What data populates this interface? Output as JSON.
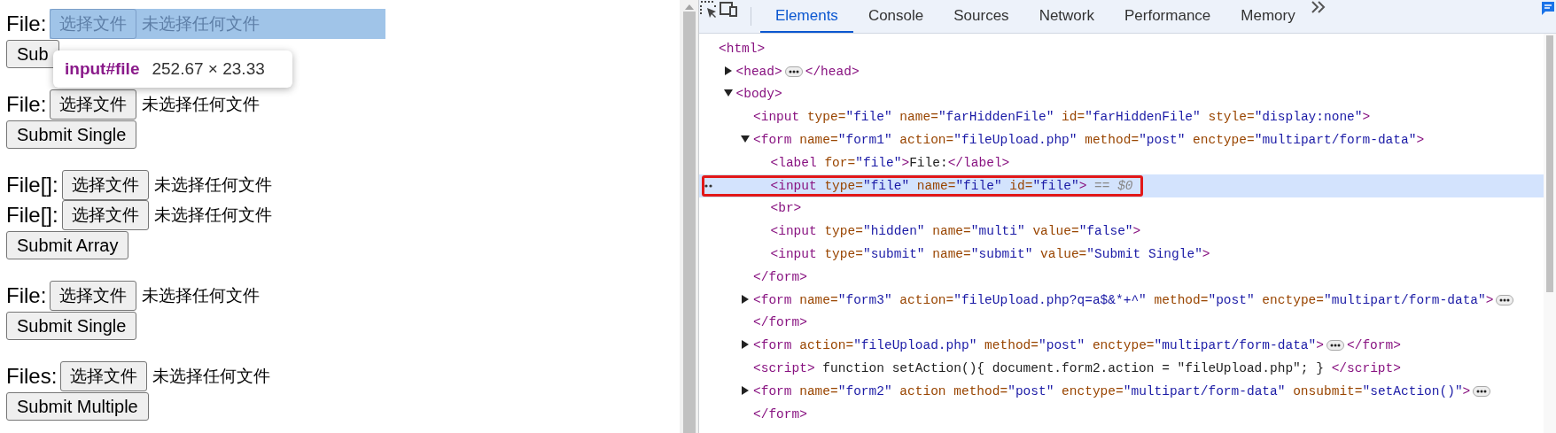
{
  "page": {
    "forms": [
      {
        "inputs": [
          {
            "label": "File:",
            "button": "选择文件",
            "status": "未选择任何文件",
            "highlighted": true
          }
        ],
        "submit": "Sub"
      },
      {
        "inputs": [
          {
            "label": "File:",
            "button": "选择文件",
            "status": "未选择任何文件",
            "highlighted": false
          }
        ],
        "submit": "Submit Single"
      },
      {
        "inputs": [
          {
            "label": "File[]:",
            "button": "选择文件",
            "status": "未选择任何文件",
            "highlighted": false
          },
          {
            "label": "File[]:",
            "button": "选择文件",
            "status": "未选择任何文件",
            "highlighted": false
          }
        ],
        "submit": "Submit Array"
      },
      {
        "inputs": [
          {
            "label": "File:",
            "button": "选择文件",
            "status": "未选择任何文件",
            "highlighted": false
          }
        ],
        "submit": "Submit Single"
      },
      {
        "inputs": [
          {
            "label": "Files:",
            "button": "选择文件",
            "status": "未选择任何文件",
            "highlighted": false
          }
        ],
        "submit": "Submit Multiple"
      }
    ],
    "inspect_tooltip": {
      "selector": "input#file",
      "size": "252.67 × 23.33"
    }
  },
  "devtools": {
    "tabs": [
      {
        "label": "Elements",
        "selected": true
      },
      {
        "label": "Console",
        "selected": false
      },
      {
        "label": "Sources",
        "selected": false
      },
      {
        "label": "Network",
        "selected": false
      },
      {
        "label": "Performance",
        "selected": false
      },
      {
        "label": "Memory",
        "selected": false
      }
    ],
    "tree": [
      {
        "selected": false,
        "open": [
          {
            "kind": "code",
            "spans": [
              {
                "kind": "tag",
                "text": "<html>"
              }
            ]
          }
        ],
        "children": [
          {
            "selected": false,
            "expanded": false,
            "open": [
              {
                "kind": "code",
                "spans": [
                  {
                    "kind": "tag",
                    "text": "<head>"
                  }
                ]
              },
              {
                "kind": "ellipsis"
              },
              {
                "kind": "code",
                "spans": [
                  {
                    "kind": "tag",
                    "text": "</head>"
                  }
                ]
              }
            ]
          },
          {
            "selected": false,
            "expanded": true,
            "open": [
              {
                "kind": "code",
                "spans": [
                  {
                    "kind": "tag",
                    "text": "<body>"
                  }
                ]
              }
            ],
            "children": [
              {
                "selected": false,
                "open": [
                  {
                    "kind": "code",
                    "spans": [
                      {
                        "kind": "tag",
                        "text": "<input"
                      },
                      {
                        "kind": "name",
                        "text": " type="
                      },
                      {
                        "kind": "value",
                        "text": "\"file\""
                      },
                      {
                        "kind": "name",
                        "text": " name="
                      },
                      {
                        "kind": "value",
                        "text": "\"farHiddenFile\""
                      },
                      {
                        "kind": "name",
                        "text": " id="
                      },
                      {
                        "kind": "value",
                        "text": "\"farHiddenFile\""
                      },
                      {
                        "kind": "name",
                        "text": " style="
                      },
                      {
                        "kind": "value",
                        "text": "\"display:none\""
                      },
                      {
                        "kind": "tag",
                        "text": ">"
                      }
                    ]
                  }
                ]
              },
              {
                "selected": false,
                "expanded": true,
                "open": [
                  {
                    "kind": "code",
                    "spans": [
                      {
                        "kind": "tag",
                        "text": "<form"
                      },
                      {
                        "kind": "name",
                        "text": " name="
                      },
                      {
                        "kind": "value",
                        "text": "\"form1\""
                      },
                      {
                        "kind": "name",
                        "text": " action="
                      },
                      {
                        "kind": "value",
                        "text": "\"fileUpload.php\""
                      },
                      {
                        "kind": "name",
                        "text": " method="
                      },
                      {
                        "kind": "value",
                        "text": "\"post\""
                      },
                      {
                        "kind": "name",
                        "text": " enctype="
                      },
                      {
                        "kind": "value",
                        "text": "\"multipart/form-data\""
                      },
                      {
                        "kind": "tag",
                        "text": ">"
                      }
                    ]
                  }
                ],
                "children": [
                  {
                    "selected": false,
                    "open": [
                      {
                        "kind": "code",
                        "spans": [
                          {
                            "kind": "tag",
                            "text": "<label"
                          },
                          {
                            "kind": "name",
                            "text": " for="
                          },
                          {
                            "kind": "value",
                            "text": "\"file\""
                          },
                          {
                            "kind": "tag",
                            "text": ">"
                          },
                          {
                            "kind": "text",
                            "text": "File:"
                          },
                          {
                            "kind": "tag",
                            "text": "</label>"
                          }
                        ]
                      }
                    ]
                  },
                  {
                    "selected": true,
                    "outlined": true,
                    "open": [
                      {
                        "kind": "code",
                        "spans": [
                          {
                            "kind": "tag",
                            "text": "<input"
                          },
                          {
                            "kind": "name",
                            "text": " type="
                          },
                          {
                            "kind": "value",
                            "text": "\"file\""
                          },
                          {
                            "kind": "name",
                            "text": " name="
                          },
                          {
                            "kind": "value",
                            "text": "\"file\""
                          },
                          {
                            "kind": "name",
                            "text": " id="
                          },
                          {
                            "kind": "value",
                            "text": "\"file\""
                          },
                          {
                            "kind": "tag",
                            "text": ">"
                          },
                          {
                            "kind": "hint",
                            "text": " == $0"
                          }
                        ]
                      }
                    ]
                  },
                  {
                    "selected": false,
                    "open": [
                      {
                        "kind": "code",
                        "spans": [
                          {
                            "kind": "tag",
                            "text": "<br>"
                          }
                        ]
                      }
                    ]
                  },
                  {
                    "selected": false,
                    "open": [
                      {
                        "kind": "code",
                        "spans": [
                          {
                            "kind": "tag",
                            "text": "<input"
                          },
                          {
                            "kind": "name",
                            "text": " type="
                          },
                          {
                            "kind": "value",
                            "text": "\"hidden\""
                          },
                          {
                            "kind": "name",
                            "text": " name="
                          },
                          {
                            "kind": "value",
                            "text": "\"multi\""
                          },
                          {
                            "kind": "name",
                            "text": " value="
                          },
                          {
                            "kind": "value",
                            "text": "\"false\""
                          },
                          {
                            "kind": "tag",
                            "text": ">"
                          }
                        ]
                      }
                    ]
                  },
                  {
                    "selected": false,
                    "open": [
                      {
                        "kind": "code",
                        "spans": [
                          {
                            "kind": "tag",
                            "text": "<input"
                          },
                          {
                            "kind": "name",
                            "text": " type="
                          },
                          {
                            "kind": "value",
                            "text": "\"submit\""
                          },
                          {
                            "kind": "name",
                            "text": " name="
                          },
                          {
                            "kind": "value",
                            "text": "\"submit\""
                          },
                          {
                            "kind": "name",
                            "text": " value="
                          },
                          {
                            "kind": "value",
                            "text": "\"Submit Single\""
                          },
                          {
                            "kind": "tag",
                            "text": ">"
                          }
                        ]
                      }
                    ]
                  }
                ],
                "close": [
                  {
                    "kind": "tag",
                    "text": "</form>"
                  }
                ]
              },
              {
                "selected": false,
                "expanded": false,
                "open": [
                  {
                    "kind": "code",
                    "spans": [
                      {
                        "kind": "tag",
                        "text": "<form"
                      },
                      {
                        "kind": "name",
                        "text": " name="
                      },
                      {
                        "kind": "value",
                        "text": "\"form3\""
                      },
                      {
                        "kind": "name",
                        "text": " action="
                      },
                      {
                        "kind": "value",
                        "text": "\"fileUpload.php?q=a$&*+^\""
                      },
                      {
                        "kind": "name",
                        "text": " method="
                      },
                      {
                        "kind": "value",
                        "text": "\"post\""
                      },
                      {
                        "kind": "name",
                        "text": " enctype="
                      },
                      {
                        "kind": "value",
                        "text": "\"multipart/form-data\""
                      },
                      {
                        "kind": "tag",
                        "text": ">"
                      }
                    ]
                  },
                  {
                    "kind": "ellipsis"
                  }
                ],
                "close": [
                  {
                    "kind": "tag",
                    "text": "</form>"
                  }
                ]
              },
              {
                "selected": false,
                "expanded": false,
                "open": [
                  {
                    "kind": "code",
                    "spans": [
                      {
                        "kind": "tag",
                        "text": "<form"
                      },
                      {
                        "kind": "name",
                        "text": " action="
                      },
                      {
                        "kind": "value",
                        "text": "\"fileUpload.php\""
                      },
                      {
                        "kind": "name",
                        "text": " method="
                      },
                      {
                        "kind": "value",
                        "text": "\"post\""
                      },
                      {
                        "kind": "name",
                        "text": " enctype="
                      },
                      {
                        "kind": "value",
                        "text": "\"multipart/form-data\""
                      },
                      {
                        "kind": "tag",
                        "text": ">"
                      }
                    ]
                  },
                  {
                    "kind": "ellipsis"
                  },
                  {
                    "kind": "code",
                    "spans": [
                      {
                        "kind": "tag",
                        "text": "</form>"
                      }
                    ]
                  }
                ]
              },
              {
                "selected": false,
                "open": [
                  {
                    "kind": "code",
                    "spans": [
                      {
                        "kind": "tag",
                        "text": "<script>"
                      },
                      {
                        "kind": "text",
                        "text": " function setAction(){ document.form2.action = \"fileUpload.php\"; } "
                      },
                      {
                        "kind": "tag",
                        "text": "</script>"
                      }
                    ]
                  }
                ]
              },
              {
                "selected": false,
                "expanded": false,
                "open": [
                  {
                    "kind": "code",
                    "spans": [
                      {
                        "kind": "tag",
                        "text": "<form"
                      },
                      {
                        "kind": "name",
                        "text": " name="
                      },
                      {
                        "kind": "value",
                        "text": "\"form2\""
                      },
                      {
                        "kind": "name",
                        "text": " action method="
                      },
                      {
                        "kind": "value",
                        "text": "\"post\""
                      },
                      {
                        "kind": "name",
                        "text": " enctype="
                      },
                      {
                        "kind": "value",
                        "text": "\"multipart/form-data\""
                      },
                      {
                        "kind": "name",
                        "text": " onsubmit="
                      },
                      {
                        "kind": "value",
                        "text": "\"setAction()\""
                      },
                      {
                        "kind": "tag",
                        "text": ">"
                      }
                    ]
                  },
                  {
                    "kind": "ellipsis"
                  }
                ],
                "close": [
                  {
                    "kind": "tag",
                    "text": "</form>"
                  }
                ]
              }
            ]
          }
        ]
      }
    ]
  }
}
